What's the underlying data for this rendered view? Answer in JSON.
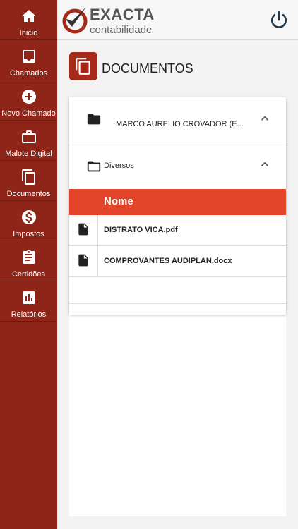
{
  "sidebar": {
    "items": [
      {
        "label": "Inicio",
        "icon": "home-icon"
      },
      {
        "label": "Chamados",
        "icon": "inbox-icon"
      },
      {
        "label": "Novo Chamado",
        "icon": "add-circle-icon"
      },
      {
        "label": "Malote Digital",
        "icon": "briefcase-icon"
      },
      {
        "label": "Documentos",
        "icon": "copy-icon"
      },
      {
        "label": "Impostos",
        "icon": "dollar-icon"
      },
      {
        "label": "Certidões",
        "icon": "clipboard-icon"
      },
      {
        "label": "Relatórios",
        "icon": "bar-chart-icon"
      }
    ]
  },
  "header": {
    "logo_title": "EXACTA",
    "logo_subtitle": "contabilidade"
  },
  "page": {
    "title": "DOCUMENTOS"
  },
  "documents": {
    "client_name": "MARCO AURELIO CROVADOR (E...",
    "folder_name": "Diversos",
    "column_header": "Nome",
    "files": [
      {
        "name": "DISTRATO VICA.pdf"
      },
      {
        "name": "COMPROVANTES AUDIPLAN.docx"
      }
    ]
  },
  "colors": {
    "sidebar": "#8f2418",
    "accent": "#e3452a",
    "title_icon": "#a52a1a"
  }
}
